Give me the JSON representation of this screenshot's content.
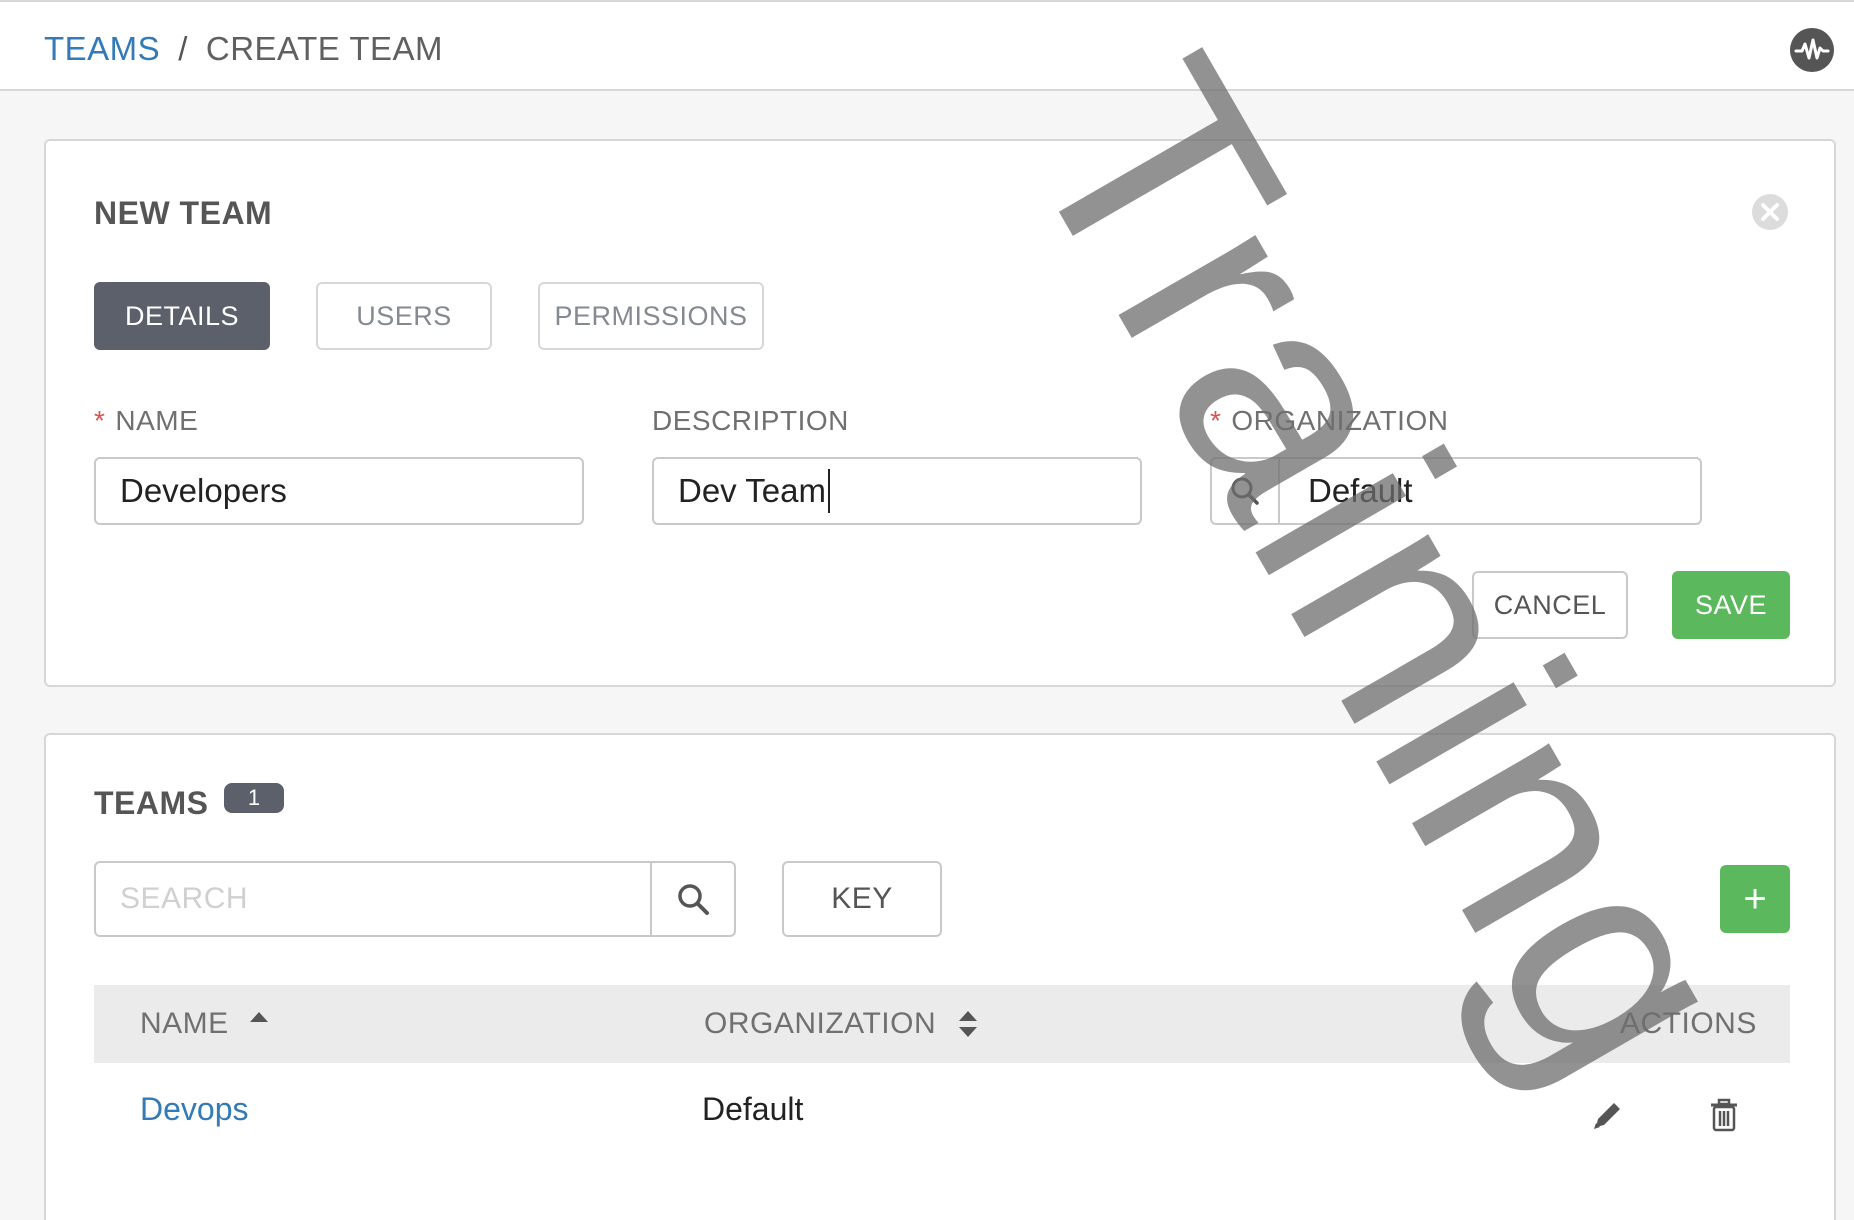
{
  "breadcrumb": {
    "parent": "TEAMS",
    "separator": "/",
    "current": "CREATE TEAM"
  },
  "form": {
    "title": "NEW TEAM",
    "tabs": [
      {
        "label": "DETAILS",
        "active": true
      },
      {
        "label": "USERS",
        "active": false
      },
      {
        "label": "PERMISSIONS",
        "active": false
      }
    ],
    "name": {
      "required_mark": "*",
      "label": "NAME",
      "value": "Developers"
    },
    "description": {
      "label": "DESCRIPTION",
      "value": "Dev Team"
    },
    "organization": {
      "required_mark": "*",
      "label": "ORGANIZATION",
      "value": "Default"
    },
    "cancel_label": "CANCEL",
    "save_label": "SAVE"
  },
  "list": {
    "title": "TEAMS",
    "count": "1",
    "search_placeholder": "SEARCH",
    "key_label": "KEY",
    "add_label": "+",
    "columns": {
      "name": "NAME",
      "organization": "ORGANIZATION",
      "actions": "ACTIONS"
    },
    "rows": [
      {
        "name": "Devops",
        "organization": "Default"
      }
    ]
  },
  "watermark": "Training",
  "colors": {
    "link": "#337ab7",
    "active_tab": "#5b606b",
    "success": "#5cb85c",
    "required": "#d9534f"
  },
  "icons": [
    "activity-icon",
    "close-icon",
    "search-icon",
    "sort-asc-icon",
    "sort-icon",
    "edit-icon",
    "delete-icon"
  ]
}
